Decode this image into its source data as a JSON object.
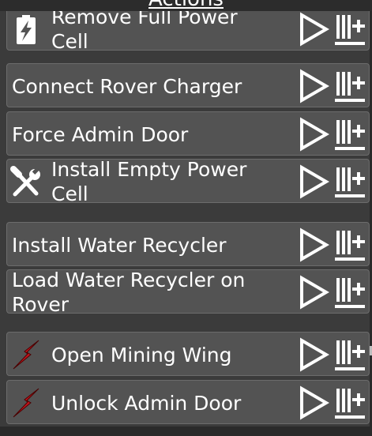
{
  "header": {
    "title": "Actions"
  },
  "actions": [
    {
      "label_lines": [
        "Remove Full Power",
        "Cell"
      ],
      "icon": "battery-bolt-icon"
    },
    {
      "label_lines": [
        "Connect Rover Charger"
      ],
      "icon": ""
    },
    {
      "label_lines": [
        "Force Admin Door"
      ],
      "icon": ""
    },
    {
      "label_lines": [
        "Install Empty Power",
        "Cell"
      ],
      "icon": "wrench-screwdriver-icon"
    },
    {
      "label_lines": [
        "Install Water Recycler"
      ],
      "icon": ""
    },
    {
      "label_lines": [
        "Load Water Recycler on",
        "Rover"
      ],
      "icon": ""
    },
    {
      "label_lines": [
        "Open Mining Wing"
      ],
      "icon": "red-lightning-icon"
    },
    {
      "label_lines": [
        "Unlock Admin Door"
      ],
      "icon": "red-lightning-icon"
    }
  ],
  "controls": {
    "play_icon": "play-icon",
    "queue_icon": "queue-add-icon"
  },
  "colors": {
    "background": "#3b3b3b",
    "row": "#535353",
    "row_border": "#6c6c6c",
    "text": "#ffffff",
    "lightning": "#c0141c",
    "progress": "#5fae5f"
  }
}
